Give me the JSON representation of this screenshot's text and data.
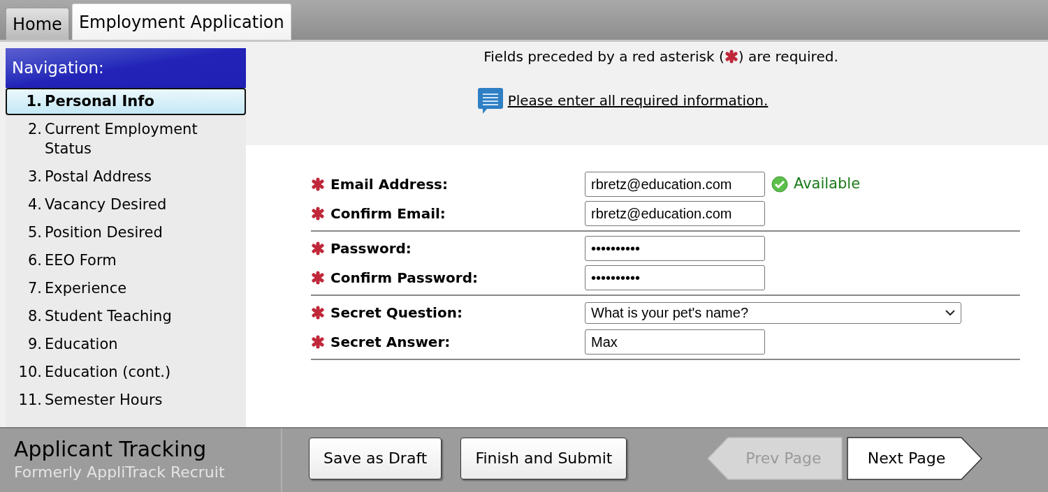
{
  "tabs": [
    {
      "label": "Home",
      "selected": false
    },
    {
      "label": "Employment Application",
      "selected": true
    }
  ],
  "navigation": {
    "title": "Navigation:",
    "items": [
      {
        "number": "1.",
        "label": "Personal Info",
        "selected": true
      },
      {
        "number": "2.",
        "label": "Current Employment Status",
        "selected": false
      },
      {
        "number": "3.",
        "label": "Postal Address",
        "selected": false
      },
      {
        "number": "4.",
        "label": "Vacancy Desired",
        "selected": false
      },
      {
        "number": "5.",
        "label": "Position Desired",
        "selected": false
      },
      {
        "number": "6.",
        "label": "EEO Form",
        "selected": false
      },
      {
        "number": "7.",
        "label": "Experience",
        "selected": false
      },
      {
        "number": "8.",
        "label": "Student Teaching",
        "selected": false
      },
      {
        "number": "9.",
        "label": "Education",
        "selected": false
      },
      {
        "number": "10.",
        "label": "Education (cont.)",
        "selected": false
      },
      {
        "number": "11.",
        "label": "Semester Hours",
        "selected": false
      }
    ]
  },
  "notice": {
    "before_icon": "Fields preceded by a red asterisk (",
    "after_icon": ") are required.",
    "message": "Please enter all required information."
  },
  "form_groups": [
    [
      {
        "label": "Email Address:",
        "required": true,
        "kind": "text",
        "value": "rbretz@education.com",
        "status": "Available"
      },
      {
        "label": "Confirm Email:",
        "required": true,
        "kind": "text",
        "value": "rbretz@education.com"
      }
    ],
    [
      {
        "label": "Password:",
        "required": true,
        "kind": "password",
        "value": "••••••••••"
      },
      {
        "label": "Confirm Password:",
        "required": true,
        "kind": "password",
        "value": "••••••••••"
      }
    ],
    [
      {
        "label": "Secret Question:",
        "required": true,
        "kind": "select",
        "value": "What is your pet's name?"
      },
      {
        "label": "Secret Answer:",
        "required": true,
        "kind": "text",
        "value": "Max"
      }
    ]
  ],
  "footer": {
    "brand": "Applicant Tracking",
    "subtitle": "Formerly AppliTrack Recruit",
    "buttons": [
      {
        "label": "Save as Draft",
        "kind": "plain",
        "disabled": false
      },
      {
        "label": "Finish and Submit",
        "kind": "plain",
        "disabled": false
      },
      {
        "label": "Prev Page",
        "kind": "prev",
        "disabled": true
      },
      {
        "label": "Next Page",
        "kind": "next",
        "disabled": false
      }
    ]
  }
}
